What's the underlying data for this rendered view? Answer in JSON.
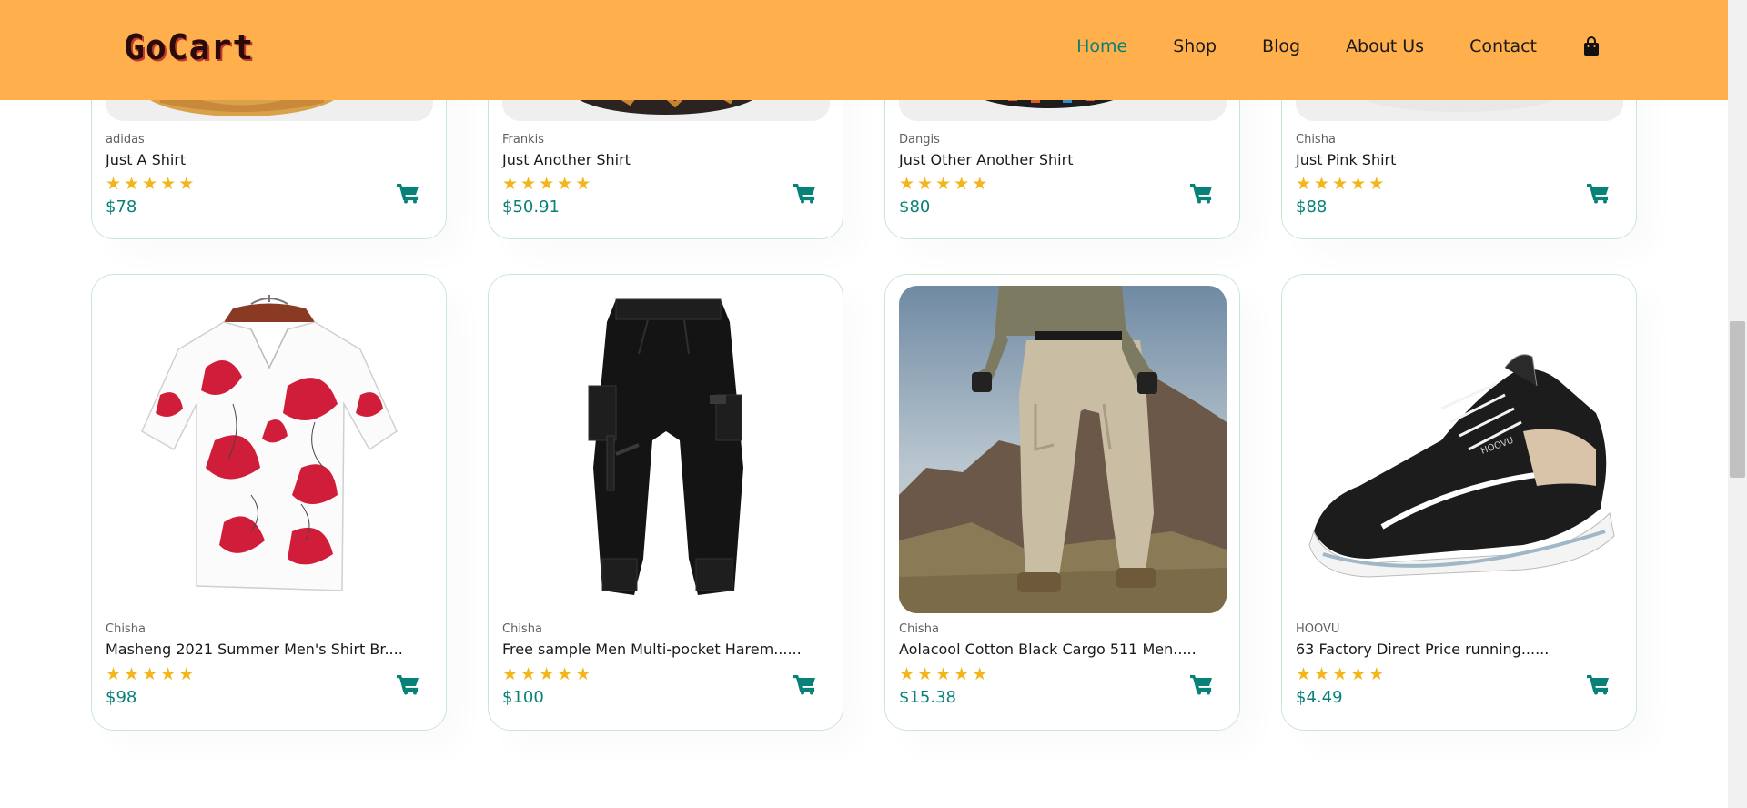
{
  "header": {
    "logo": "GoCart",
    "nav": [
      {
        "label": "Home",
        "active": true
      },
      {
        "label": "Shop",
        "active": false
      },
      {
        "label": "Blog",
        "active": false
      },
      {
        "label": "About Us",
        "active": false
      },
      {
        "label": "Contact",
        "active": false
      }
    ],
    "bag_icon": "shopping-bag-icon",
    "color": "#FFAF4B",
    "accent": "#088178"
  },
  "products_top": [
    {
      "brand": "adidas",
      "title": "Just A Shirt",
      "stars": 5,
      "price": "$78"
    },
    {
      "brand": "Frankis",
      "title": "Just Another Shirt",
      "stars": 5,
      "price": "$50.91"
    },
    {
      "brand": "Dangis",
      "title": "Just Other Another Shirt",
      "stars": 5,
      "price": "$80"
    },
    {
      "brand": "Chisha",
      "title": "Just Pink Shirt",
      "stars": 5,
      "price": "$88"
    }
  ],
  "products_bottom": [
    {
      "brand": "Chisha",
      "title": "Masheng 2021 Summer Men's Shirt Br....",
      "stars": 5,
      "price": "$98",
      "image": "floral-shirt"
    },
    {
      "brand": "Chisha",
      "title": "Free sample Men Multi-pocket Harem......",
      "stars": 5,
      "price": "$100",
      "image": "black-cargo-pants"
    },
    {
      "brand": "Chisha",
      "title": "Aolacool Cotton Black Cargo 511 Men.....",
      "stars": 5,
      "price": "$15.38",
      "image": "khaki-cargo-pants"
    },
    {
      "brand": "HOOVU",
      "title": "63 Factory Direct Price running......",
      "stars": 5,
      "price": "$4.49",
      "image": "running-shoe"
    }
  ],
  "star_glyph": "★",
  "cart_icon": "cart-icon"
}
